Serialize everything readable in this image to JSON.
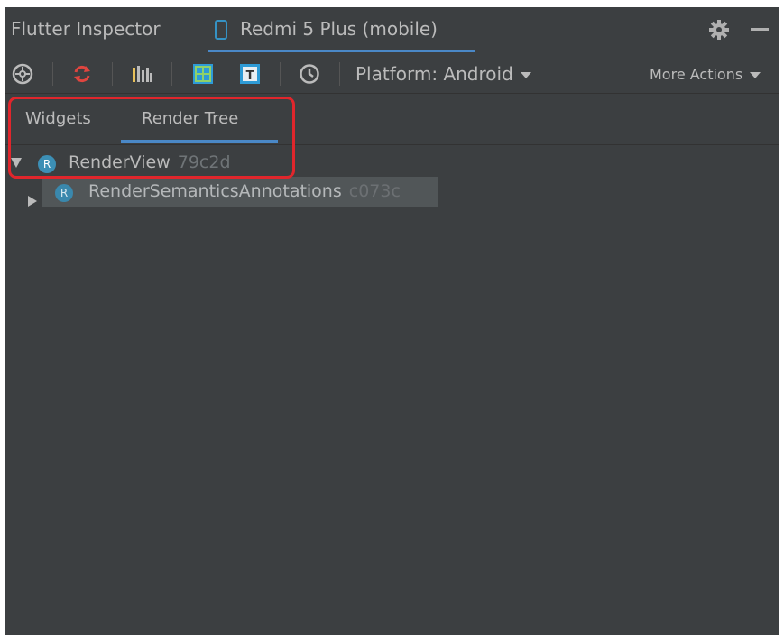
{
  "titlebar": {
    "tool_title": "Flutter Inspector",
    "device_tab": "Redmi 5 Plus (mobile)"
  },
  "toolbar": {
    "platform_label": "Platform: Android",
    "more_actions_label": "More Actions"
  },
  "tabs": [
    {
      "label": "Widgets"
    },
    {
      "label": "Render Tree"
    }
  ],
  "tree": {
    "nodes": [
      {
        "badge": "R",
        "name": "RenderView",
        "id": "79c2d"
      },
      {
        "badge": "R",
        "name": "RenderSemanticsAnnotations",
        "id": "c073c"
      }
    ]
  },
  "colors": {
    "panel_bg": "#3c3f41",
    "accent_blue": "#4a88c7",
    "highlight_red": "#e0262c",
    "selected_row_bg": "#515658"
  }
}
